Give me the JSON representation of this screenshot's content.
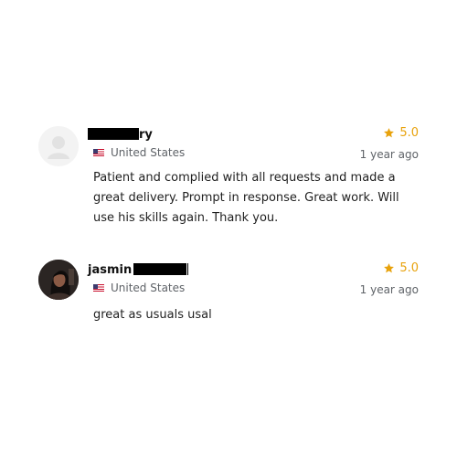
{
  "reviews": [
    {
      "name_visible": "ry",
      "location": "United States",
      "rating": "5.0",
      "time": "1 year ago",
      "text": "Patient and complied with all requests and made a great delivery. Prompt in response. Great work. Will use his skills again. Thank you."
    },
    {
      "name_visible": "jasmin",
      "location": "United States",
      "rating": "5.0",
      "time": "1 year ago",
      "text": "great as usuals usal"
    }
  ],
  "colors": {
    "star": "#e8a20c",
    "muted": "#5f6368",
    "avatar_placeholder": "#f2f2f2"
  },
  "icons": {
    "star": "star-icon",
    "flag": "us-flag-icon",
    "default_avatar": "user-placeholder-icon"
  }
}
